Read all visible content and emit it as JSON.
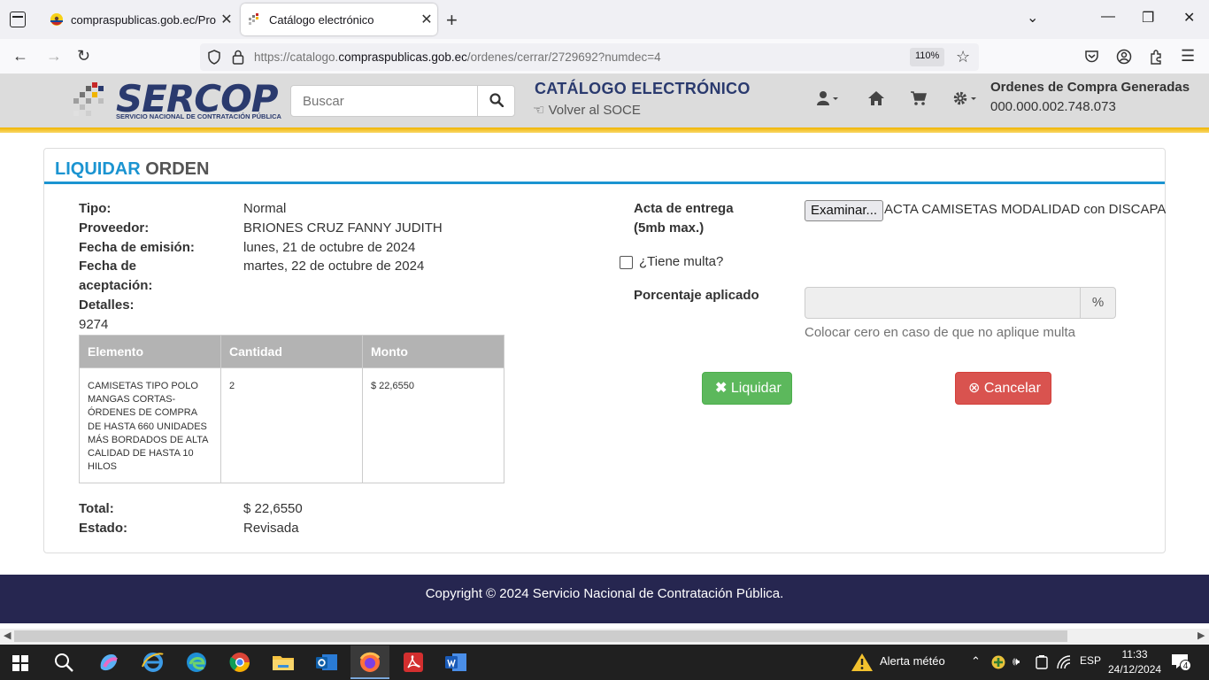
{
  "browser": {
    "tabs": [
      {
        "title": "compraspublicas.gob.ec/Proce",
        "active": false
      },
      {
        "title": "Catálogo electrónico",
        "active": true
      }
    ],
    "url_prefix": "https://catalogo.",
    "url_domain": "compraspublicas.gob.ec",
    "url_path": "/ordenes/cerrar/2729692?numdec=4",
    "zoom": "110%"
  },
  "header": {
    "logo_word": "SERCOP",
    "logo_tagline": "SERVICIO NACIONAL DE CONTRATACIÓN PÚBLICA",
    "search_placeholder": "Buscar",
    "catalog_title": "CATÁLOGO ELECTRÓNICO",
    "back_link": "Volver al SOCE",
    "orders_label": "Ordenes de Compra Generadas",
    "orders_count": "000.000.002.748.073"
  },
  "panel": {
    "title_part1": "LIQUIDAR",
    "title_part2": "ORDEN",
    "tipo_label": "Tipo:",
    "tipo_value": "Normal",
    "proveedor_label": "Proveedor:",
    "proveedor_value": "BRIONES CRUZ FANNY JUDITH",
    "emision_label": "Fecha de emisión:",
    "emision_value": "lunes, 21 de octubre de 2024",
    "aceptacion_label": "Fecha de aceptación:",
    "aceptacion_value": "martes, 22 de octubre de 2024",
    "detalles_label": "Detalles:",
    "detalles_value": "9274",
    "table": {
      "headers": [
        "Elemento",
        "Cantidad",
        "Monto"
      ],
      "rows": [
        [
          "CAMISETAS TIPO POLO MANGAS CORTAS-ÓRDENES DE COMPRA DE HASTA 660 UNIDADES MÁS BORDADOS DE ALTA CALIDAD DE HASTA 10 HILOS",
          "2",
          "$ 22,6550"
        ]
      ]
    },
    "total_label": "Total:",
    "total_value": "$ 22,6550",
    "estado_label": "Estado:",
    "estado_value": "Revisada",
    "acta_label": "Acta de entrega (5mb max.)",
    "file_button": "Examinar...",
    "file_name": "ACTA CAMISETAS MODALIDAD con DISCAPACIDAD",
    "multa_label": "¿Tiene multa?",
    "porcentaje_label": "Porcentaje aplicado",
    "porcentaje_addon": "%",
    "help_text": "Colocar cero en caso de que no aplique multa",
    "liquidar_button": "Liquidar",
    "cancelar_button": "Cancelar"
  },
  "footer": {
    "copyright": "Copyright © 2024 Servicio Nacional de Contratación Pública."
  },
  "taskbar": {
    "weather_alert": "Alerta météo",
    "language": "ESP",
    "time": "11:33",
    "date": "24/12/2024",
    "notifications": "4"
  },
  "colors": {
    "accent_blue": "#1b94d1",
    "sercop_navy": "#2a3a6e",
    "success": "#5cb85c",
    "danger": "#d9534f",
    "footer_bg": "#262650",
    "header_stripe": "#f0b400"
  }
}
